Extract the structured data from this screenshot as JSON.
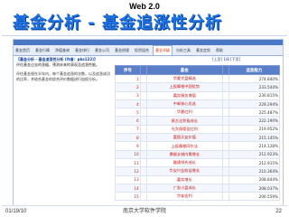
{
  "header": {
    "top_label": "Web 2.0",
    "title": "基金分析 - 基金追涨性分析"
  },
  "screenshot": {
    "tabs": [
      "基金首页",
      "基金行情",
      "净值查询",
      "基金排行",
      "基金公司",
      "基金经理",
      "投资组合",
      "基金评级",
      "分析工具",
      "基金定投",
      "帮助"
    ],
    "active_tab_index": 7,
    "left_heading": "【基金分析 - 基金追涨性分析 (作者：pbs122)】",
    "left_subtext": "评估基金过去的涨幅，预测未来的表现及追涨性能。",
    "left_paragraph": "评估基金规在半年内，每个基金追涨的次数，以及追涨成功的比率，并结合基金的综合评价数据进行加权分析。",
    "pager": "[上页] 1/8 [下页]",
    "table": {
      "headers": [
        "序号",
        "",
        "基金",
        "",
        "追涨能力"
      ],
      "rows": [
        [
          "1",
          "",
          "华夏大盘精选",
          "",
          "274.840%"
        ],
        [
          "2",
          "",
          "上投摩根中国优势",
          "",
          "233.544%"
        ],
        [
          "3",
          "",
          "嘉实服务增值",
          "",
          "230.815%"
        ],
        [
          "4",
          "",
          "中邮核心优选",
          "",
          "229.294%"
        ],
        [
          "5",
          "",
          "华夏红利",
          "",
          "225.487%"
        ],
        [
          "6",
          "",
          "易方达积极成长",
          "",
          "222.190%"
        ],
        [
          "7",
          "",
          "光大保德信红利",
          "",
          "219.952%"
        ],
        [
          "8",
          "",
          "富国天益价值",
          "",
          "215.145%"
        ],
        [
          "9",
          "",
          "上投摩根阿尔法",
          "",
          "214.128%"
        ],
        [
          "10",
          "",
          "景顺长城内需增长",
          "",
          "212.923%"
        ],
        [
          "11",
          "",
          "融通领先成长",
          "",
          "212.915%"
        ],
        [
          "12",
          "",
          "华宝兴业收益增长",
          "",
          "210.364%"
        ],
        [
          "13",
          "",
          "嘉实增长",
          "",
          "208.844%"
        ],
        [
          "14",
          "",
          "广发小盘成长",
          "",
          "208.037%"
        ],
        [
          "15",
          "",
          "华安宏利",
          "",
          "206.559%"
        ]
      ]
    }
  },
  "footer": {
    "date": "01/19/10",
    "org": "南京大学软件学院",
    "page": "22"
  }
}
